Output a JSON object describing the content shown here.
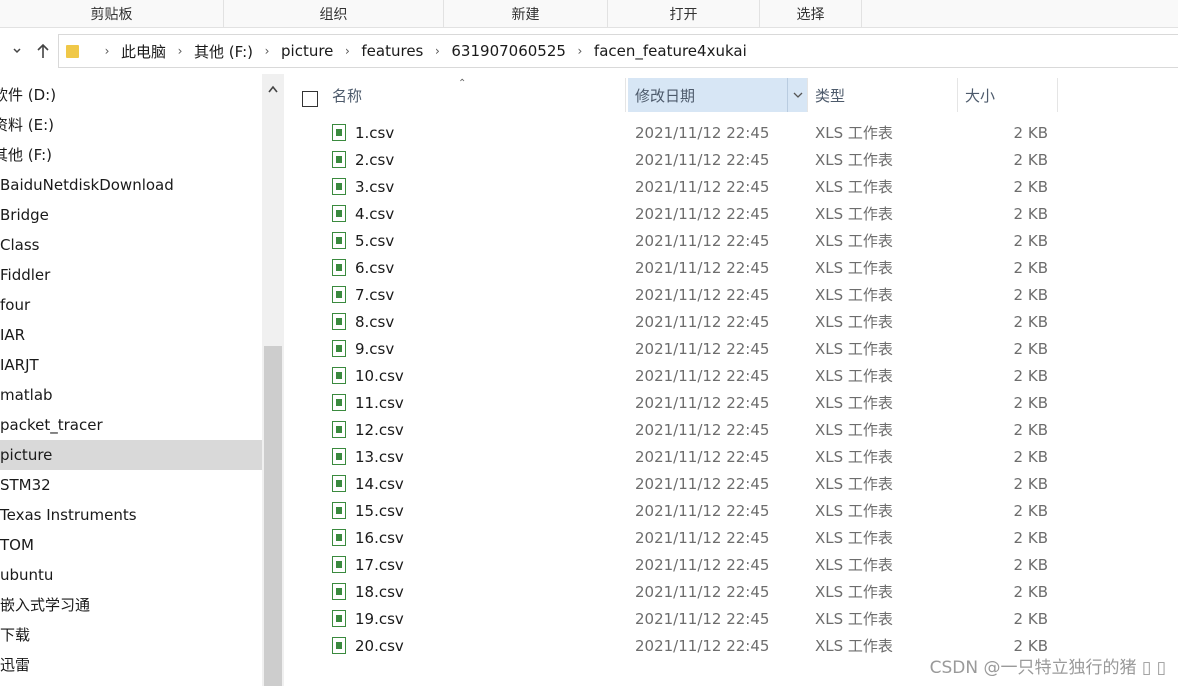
{
  "ribbon": {
    "groups": [
      "剪贴板",
      "组织",
      "新建",
      "打开",
      "选择"
    ]
  },
  "address": {
    "back_icon": "chevron-left-icon",
    "up_icon": "arrow-up-icon",
    "crumbs": [
      "此电脑",
      "其他 (F:)",
      "picture",
      "features",
      "631907060525",
      "facen_feature4xukai"
    ]
  },
  "nav": {
    "items": [
      {
        "label": "软件 (D:)"
      },
      {
        "label": "资料 (E:)"
      },
      {
        "label": "其他 (F:)"
      },
      {
        "label": "BaiduNetdiskDownload"
      },
      {
        "label": "Bridge"
      },
      {
        "label": "Class"
      },
      {
        "label": "Fiddler"
      },
      {
        "label": "four"
      },
      {
        "label": "IAR"
      },
      {
        "label": "IARJT"
      },
      {
        "label": "matlab"
      },
      {
        "label": "packet_tracer"
      },
      {
        "label": "picture",
        "selected": true
      },
      {
        "label": "STM32"
      },
      {
        "label": "Texas Instruments"
      },
      {
        "label": "TOM"
      },
      {
        "label": "ubuntu"
      },
      {
        "label": "嵌入式学习通"
      },
      {
        "label": "下载"
      },
      {
        "label": "迅雷"
      }
    ]
  },
  "columns": {
    "name": "名称",
    "date": "修改日期",
    "type": "类型",
    "size": "大小"
  },
  "files": [
    {
      "name": "1.csv",
      "date": "2021/11/12 22:45",
      "type": "XLS 工作表",
      "size": "2 KB"
    },
    {
      "name": "2.csv",
      "date": "2021/11/12 22:45",
      "type": "XLS 工作表",
      "size": "2 KB"
    },
    {
      "name": "3.csv",
      "date": "2021/11/12 22:45",
      "type": "XLS 工作表",
      "size": "2 KB"
    },
    {
      "name": "4.csv",
      "date": "2021/11/12 22:45",
      "type": "XLS 工作表",
      "size": "2 KB"
    },
    {
      "name": "5.csv",
      "date": "2021/11/12 22:45",
      "type": "XLS 工作表",
      "size": "2 KB"
    },
    {
      "name": "6.csv",
      "date": "2021/11/12 22:45",
      "type": "XLS 工作表",
      "size": "2 KB"
    },
    {
      "name": "7.csv",
      "date": "2021/11/12 22:45",
      "type": "XLS 工作表",
      "size": "2 KB"
    },
    {
      "name": "8.csv",
      "date": "2021/11/12 22:45",
      "type": "XLS 工作表",
      "size": "2 KB"
    },
    {
      "name": "9.csv",
      "date": "2021/11/12 22:45",
      "type": "XLS 工作表",
      "size": "2 KB"
    },
    {
      "name": "10.csv",
      "date": "2021/11/12 22:45",
      "type": "XLS 工作表",
      "size": "2 KB"
    },
    {
      "name": "11.csv",
      "date": "2021/11/12 22:45",
      "type": "XLS 工作表",
      "size": "2 KB"
    },
    {
      "name": "12.csv",
      "date": "2021/11/12 22:45",
      "type": "XLS 工作表",
      "size": "2 KB"
    },
    {
      "name": "13.csv",
      "date": "2021/11/12 22:45",
      "type": "XLS 工作表",
      "size": "2 KB"
    },
    {
      "name": "14.csv",
      "date": "2021/11/12 22:45",
      "type": "XLS 工作表",
      "size": "2 KB"
    },
    {
      "name": "15.csv",
      "date": "2021/11/12 22:45",
      "type": "XLS 工作表",
      "size": "2 KB"
    },
    {
      "name": "16.csv",
      "date": "2021/11/12 22:45",
      "type": "XLS 工作表",
      "size": "2 KB"
    },
    {
      "name": "17.csv",
      "date": "2021/11/12 22:45",
      "type": "XLS 工作表",
      "size": "2 KB"
    },
    {
      "name": "18.csv",
      "date": "2021/11/12 22:45",
      "type": "XLS 工作表",
      "size": "2 KB"
    },
    {
      "name": "19.csv",
      "date": "2021/11/12 22:45",
      "type": "XLS 工作表",
      "size": "2 KB"
    },
    {
      "name": "20.csv",
      "date": "2021/11/12 22:45",
      "type": "XLS 工作表",
      "size": "2 KB"
    }
  ],
  "watermark": "CSDN @一只特立独行的猪 ▯ ▯",
  "colors": {
    "selected_nav": "#d9d9d9",
    "sorted_header": "#d7e6f5",
    "file_icon": "#3a8a3e"
  }
}
